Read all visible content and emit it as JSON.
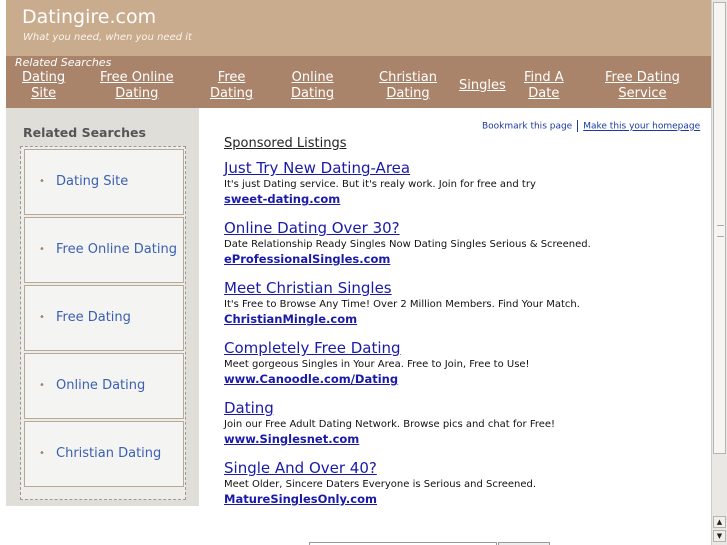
{
  "header": {
    "title": "Datingire.com",
    "tagline": "What you need, when you need it"
  },
  "navbar": {
    "heading": "Related Searches",
    "links": [
      {
        "line1": "Dating",
        "line2": "Site"
      },
      {
        "line1": "Free Online",
        "line2": "Dating"
      },
      {
        "line1": "Free",
        "line2": "Dating"
      },
      {
        "line1": "Online",
        "line2": "Dating"
      },
      {
        "line1": "Christian",
        "line2": "Dating"
      },
      {
        "line1": "Singles",
        "line2": ""
      },
      {
        "line1": "Find A",
        "line2": "Date"
      },
      {
        "line1": "Free Dating",
        "line2": "Service"
      }
    ]
  },
  "sidebar": {
    "heading": "Related Searches",
    "bullet": "•",
    "items": [
      "Dating Site",
      "Free Online Dating",
      "Free Dating",
      "Online Dating",
      "Christian Dating"
    ]
  },
  "bookmark": {
    "bookmark_label": "Bookmark this page",
    "homepage_label": "Make this your homepage"
  },
  "sponsored": {
    "heading": "Sponsored Listings",
    "listings": [
      {
        "title": "Just Try New Dating-Area",
        "desc": "It's just Dating service. But it's realy work. Join for free and try",
        "url": "sweet-dating.com"
      },
      {
        "title": "Online Dating Over 30?",
        "desc": "Date Relationship Ready Singles Now Dating Singles Serious & Screened.",
        "url": "eProfessionalSingles.com"
      },
      {
        "title": "Meet Christian Singles",
        "desc": "It's Free to Browse Any Time! Over 2 Million Members. Find Your Match.",
        "url": "ChristianMingle.com"
      },
      {
        "title": "Completely Free Dating",
        "desc": "Meet gorgeous Singles in Your Area. Free to Join, Free to Use!",
        "url": "www.Canoodle.com/Dating"
      },
      {
        "title": "Dating",
        "desc": "Join our Free Adult Dating Network. Browse pics and chat for Free!",
        "url": "www.Singlesnet.com"
      },
      {
        "title": "Single And Over 40?",
        "desc": "Meet Older, Sincere Daters Everyone is Serious and Screened.",
        "url": "MatureSinglesOnly.com"
      }
    ]
  },
  "scrollbar": {
    "up_glyph": "▲",
    "down_glyph": "▼"
  },
  "colors": {
    "header_bg": "#c9ab8e",
    "navbar_bg": "#a9846b",
    "sidebar_bg": "#e0ded9",
    "link_blue": "#1a1aa8"
  }
}
